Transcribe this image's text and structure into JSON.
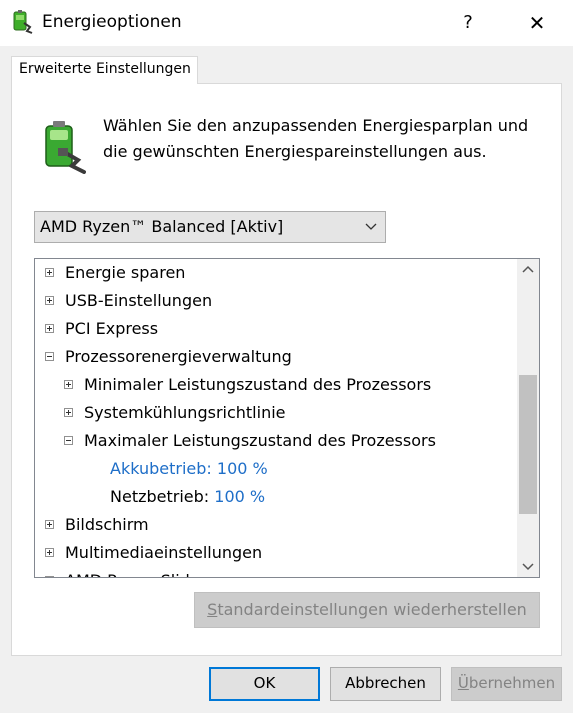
{
  "window": {
    "title": "Energieoptionen",
    "help_glyph": "?",
    "close_glyph": "✕"
  },
  "tab": {
    "label": "Erweiterte Einstellungen"
  },
  "intro": {
    "line1": "Wählen Sie den anzupassenden Energiesparplan und",
    "line2": "die gewünschten Energiespareinstellungen aus."
  },
  "plan_select": {
    "value": "AMD Ryzen™ Balanced [Aktiv]"
  },
  "tree": {
    "items": [
      {
        "label": "Energie sparen",
        "state": "collapsed"
      },
      {
        "label": "USB-Einstellungen",
        "state": "collapsed"
      },
      {
        "label": "PCI Express",
        "state": "collapsed"
      },
      {
        "label": "Prozessorenergieverwaltung",
        "state": "expanded"
      },
      {
        "label": "Minimaler Leistungszustand des Prozessors",
        "state": "collapsed"
      },
      {
        "label": "Systemkühlungsrichtlinie",
        "state": "collapsed"
      },
      {
        "label": "Maximaler Leistungszustand des Prozessors",
        "state": "expanded"
      },
      {
        "label": "Bildschirm",
        "state": "collapsed"
      },
      {
        "label": "Multimediaeinstellungen",
        "state": "collapsed"
      },
      {
        "label": "AMD Power Slider",
        "state": "collapsed"
      }
    ],
    "settings": [
      {
        "label": "Akkubetrieb:",
        "value": "100 %"
      },
      {
        "label": "Netzbetrieb:",
        "value": "100 %"
      }
    ]
  },
  "buttons": {
    "restore_defaults_first": "S",
    "restore_defaults_rest": "tandardeinstellungen wiederherstellen",
    "ok": "OK",
    "cancel": "Abbrechen",
    "apply_first": "Ü",
    "apply_rest": "bernehmen"
  },
  "colors": {
    "link": "#1e6ec8",
    "focus": "#0078d7",
    "disabled_text": "#838383"
  }
}
